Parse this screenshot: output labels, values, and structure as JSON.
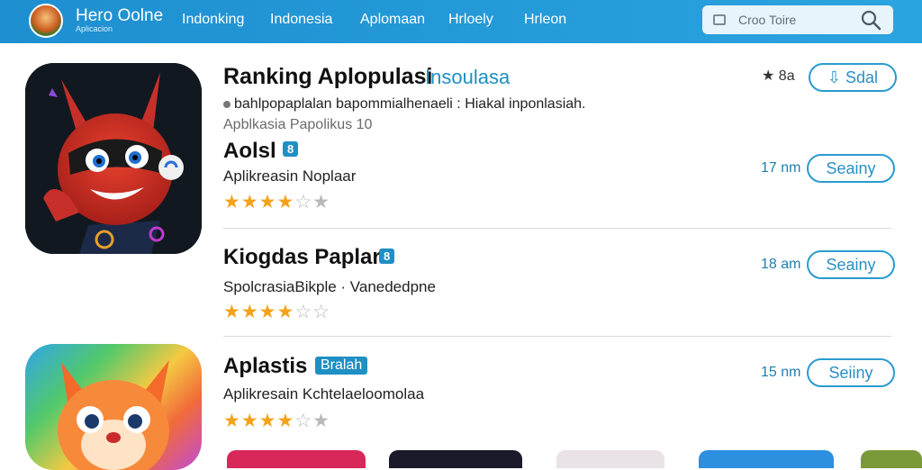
{
  "header": {
    "brand_title": "Hero Oolne",
    "brand_sub": "Aplicacion",
    "nav": [
      "Indonking",
      "Indonesia",
      "Aplomaan",
      "Hrloely",
      "Hrleon"
    ],
    "search_placeholder": "Croo Toire"
  },
  "featured": {
    "title": "Ranking Aplopulasi",
    "subtitle_link": "Insoulasa",
    "description": "bahlpopaplalan bapommialhenaeli : Hiakal inponlasiah.",
    "category": "Apblkasia Papolikus 10",
    "rating_label": "8a",
    "top_button_label": "Sdal"
  },
  "apps": [
    {
      "title": "Aolsl",
      "badge": "8",
      "subtitle": "Aplikreasin Noplaar",
      "rating": 3.5,
      "size": "17 nm",
      "button_label": "Seainy"
    },
    {
      "title": "Kiogdas Paplar",
      "badge": "8",
      "subtitle": "SpolcrasiaBikple · Vanededpne",
      "rating": 3.5,
      "size": "18 am",
      "button_label": "Seainy"
    },
    {
      "title": "Aplastis",
      "badge": "Bralah",
      "subtitle": "Aplikresain Kchtelaeloomolaa",
      "rating": 3.5,
      "size": "15 nm",
      "button_label": "Seiiny"
    }
  ],
  "colors": {
    "accent": "#1e8fd0",
    "star": "#f4a21a",
    "link": "#1d8fc0"
  }
}
